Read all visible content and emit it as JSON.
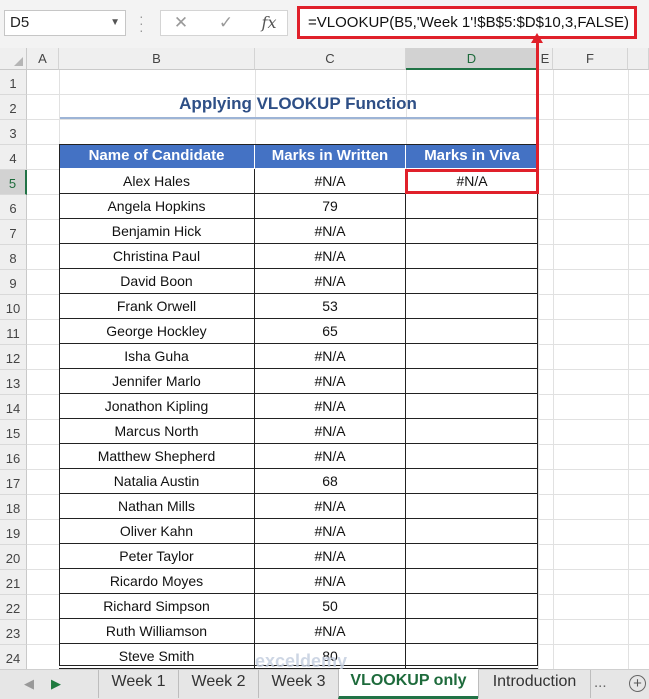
{
  "formula_bar": {
    "name_box": "D5",
    "cancel_icon": "✕",
    "enter_icon": "✓",
    "fx_label": "fx",
    "formula": "=VLOOKUP(B5,'Week 1'!$B$5:$D$10,3,FALSE)"
  },
  "columns": [
    "A",
    "B",
    "C",
    "D",
    "E",
    "F"
  ],
  "rows": [
    "1",
    "2",
    "3",
    "4",
    "5",
    "6",
    "7",
    "8",
    "9",
    "10",
    "11",
    "12",
    "13",
    "14",
    "15",
    "16",
    "17",
    "18",
    "19",
    "20",
    "21",
    "22",
    "23",
    "24"
  ],
  "sheet": {
    "title": "Applying VLOOKUP Function",
    "headers": [
      "Name of Candidate",
      "Marks in Written",
      "Marks in Viva"
    ],
    "data": [
      {
        "name": "Alex Hales",
        "written": "#N/A",
        "viva": "#N/A"
      },
      {
        "name": "Angela Hopkins",
        "written": "79",
        "viva": ""
      },
      {
        "name": "Benjamin Hick",
        "written": "#N/A",
        "viva": ""
      },
      {
        "name": "Christina Paul",
        "written": "#N/A",
        "viva": ""
      },
      {
        "name": "David Boon",
        "written": "#N/A",
        "viva": ""
      },
      {
        "name": "Frank Orwell",
        "written": "53",
        "viva": ""
      },
      {
        "name": "George Hockley",
        "written": "65",
        "viva": ""
      },
      {
        "name": "Isha Guha",
        "written": "#N/A",
        "viva": ""
      },
      {
        "name": "Jennifer Marlo",
        "written": "#N/A",
        "viva": ""
      },
      {
        "name": "Jonathon Kipling",
        "written": "#N/A",
        "viva": ""
      },
      {
        "name": "Marcus North",
        "written": "#N/A",
        "viva": ""
      },
      {
        "name": "Matthew Shepherd",
        "written": "#N/A",
        "viva": ""
      },
      {
        "name": "Natalia Austin",
        "written": "68",
        "viva": ""
      },
      {
        "name": "Nathan Mills",
        "written": "#N/A",
        "viva": ""
      },
      {
        "name": "Oliver Kahn",
        "written": "#N/A",
        "viva": ""
      },
      {
        "name": "Peter Taylor",
        "written": "#N/A",
        "viva": ""
      },
      {
        "name": "Ricardo Moyes",
        "written": "#N/A",
        "viva": ""
      },
      {
        "name": "Richard Simpson",
        "written": "50",
        "viva": ""
      },
      {
        "name": "Ruth Williamson",
        "written": "#N/A",
        "viva": ""
      },
      {
        "name": "Steve Smith",
        "written": "80",
        "viva": ""
      }
    ]
  },
  "tabs": {
    "items": [
      "Week 1",
      "Week 2",
      "Week 3",
      "VLOOKUP only",
      "Introduction"
    ],
    "active": "VLOOKUP only",
    "more": "...",
    "add": "+"
  },
  "watermark": "exceldemy",
  "colors": {
    "header_fill": "#4472c4",
    "highlight": "#e0202a",
    "excel_green": "#217346"
  }
}
